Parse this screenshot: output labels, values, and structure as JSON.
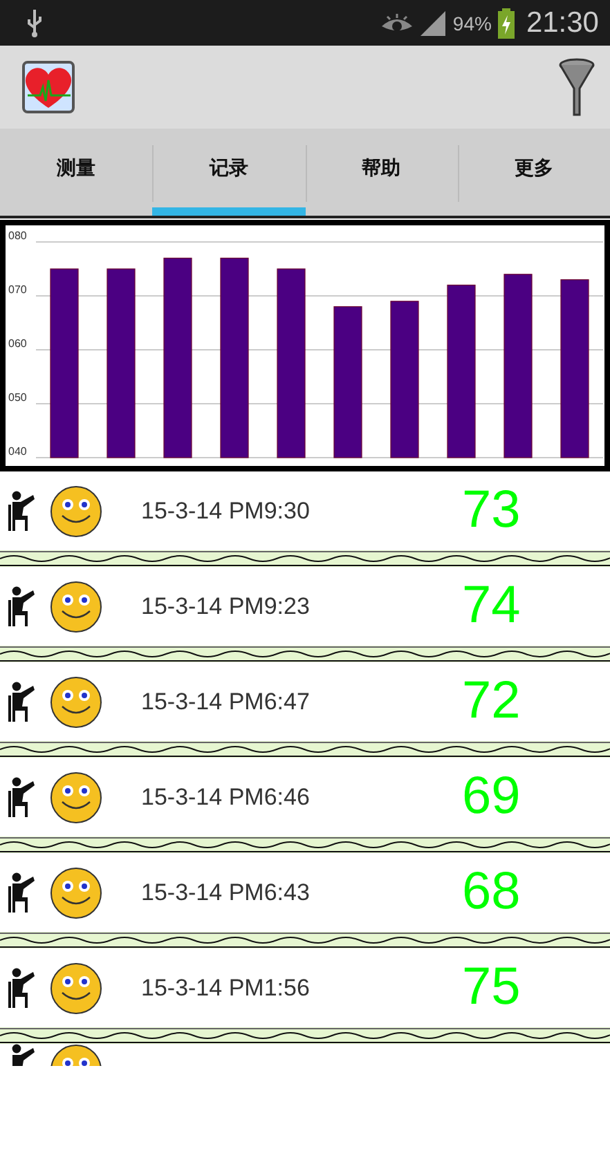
{
  "status_bar": {
    "battery": "94%",
    "time": "21:30"
  },
  "tabs": [
    {
      "label": "测量",
      "selected": false
    },
    {
      "label": "记录",
      "selected": true
    },
    {
      "label": "帮助",
      "selected": false
    },
    {
      "label": "更多",
      "selected": false
    }
  ],
  "chart_data": {
    "type": "bar",
    "values": [
      75,
      75,
      77,
      77,
      75,
      68,
      69,
      72,
      74,
      73
    ],
    "ylim": [
      40,
      80
    ],
    "yticks": [
      {
        "value": 40,
        "label": "040"
      },
      {
        "value": 50,
        "label": "050"
      },
      {
        "value": 60,
        "label": "060"
      },
      {
        "value": 70,
        "label": "070"
      },
      {
        "value": 80,
        "label": "080"
      }
    ],
    "grid": true
  },
  "records": [
    {
      "date": "15-3-14 PM9:30",
      "value": "73"
    },
    {
      "date": "15-3-14 PM9:23",
      "value": "74"
    },
    {
      "date": "15-3-14 PM6:47",
      "value": "72"
    },
    {
      "date": "15-3-14 PM6:46",
      "value": "69"
    },
    {
      "date": "15-3-14 PM6:43",
      "value": "68"
    },
    {
      "date": "15-3-14 PM1:56",
      "value": "75"
    }
  ]
}
